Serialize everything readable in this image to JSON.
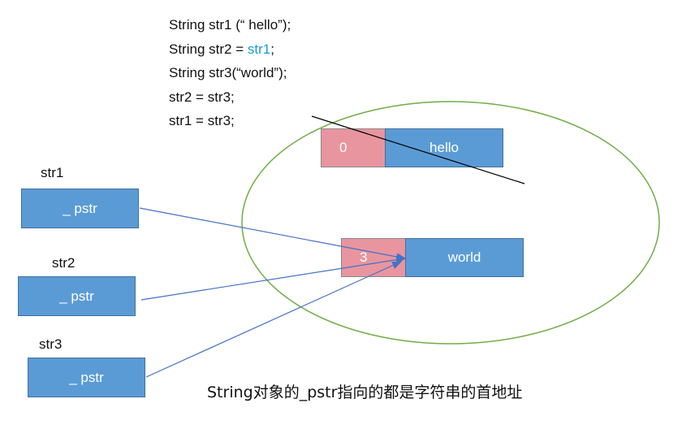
{
  "code_lines": [
    {
      "prefix": "String str1 (“ hello”);",
      "highlight": "",
      "suffix": ""
    },
    {
      "prefix": "String str2 = ",
      "highlight": "str1",
      "suffix": ";"
    },
    {
      "prefix": "String str3(“world”);",
      "highlight": "",
      "suffix": ""
    },
    {
      "prefix": "str2 = str3;",
      "highlight": "",
      "suffix": ""
    },
    {
      "prefix": "str1 = str3;",
      "highlight": "",
      "suffix": ""
    }
  ],
  "objects": [
    {
      "label": "str1",
      "field": "_ pstr"
    },
    {
      "label": "str2",
      "field": "_ pstr"
    },
    {
      "label": "str3",
      "field": "_ pstr"
    }
  ],
  "heap": {
    "hello": {
      "count": "0",
      "text": "hello"
    },
    "world": {
      "count": "3",
      "text": "world"
    }
  },
  "caption": "String对象的_pstr指向的都是字符串的首地址",
  "colors": {
    "box_fill": "#5b9bd5",
    "count_fill": "#e8959f",
    "ellipse_stroke": "#70ad47",
    "arrow": "#4472c4",
    "highlight_text": "#1a9ad6"
  }
}
